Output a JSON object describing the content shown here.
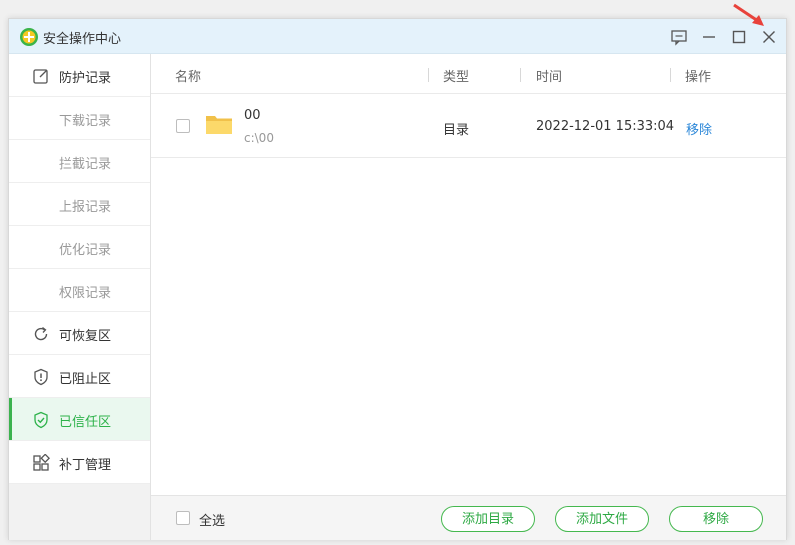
{
  "window": {
    "title": "安全操作中心"
  },
  "sidebar": {
    "items": [
      {
        "label": "防护记录",
        "icon": "edit-icon"
      },
      {
        "label": "下载记录"
      },
      {
        "label": "拦截记录"
      },
      {
        "label": "上报记录"
      },
      {
        "label": "优化记录"
      },
      {
        "label": "权限记录"
      },
      {
        "label": "可恢复区",
        "icon": "refresh-icon"
      },
      {
        "label": "已阻止区",
        "icon": "shield-alert-icon"
      },
      {
        "label": "已信任区",
        "icon": "shield-check-icon",
        "active": true
      },
      {
        "label": "补丁管理",
        "icon": "grid-icon"
      }
    ]
  },
  "table": {
    "columns": [
      "名称",
      "类型",
      "时间",
      "操作"
    ],
    "rows": [
      {
        "name": "00",
        "path": "c:\\00",
        "type": "目录",
        "time": "2022-12-01 15:33:04",
        "action": "移除"
      }
    ]
  },
  "footer": {
    "select_all": "全选",
    "add_dir": "添加目录",
    "add_file": "添加文件",
    "remove": "移除"
  },
  "colors": {
    "accent": "#2db24a",
    "link": "#2b87d8",
    "titlebar": "#e4f2fb",
    "annotation": "#e8423b"
  }
}
